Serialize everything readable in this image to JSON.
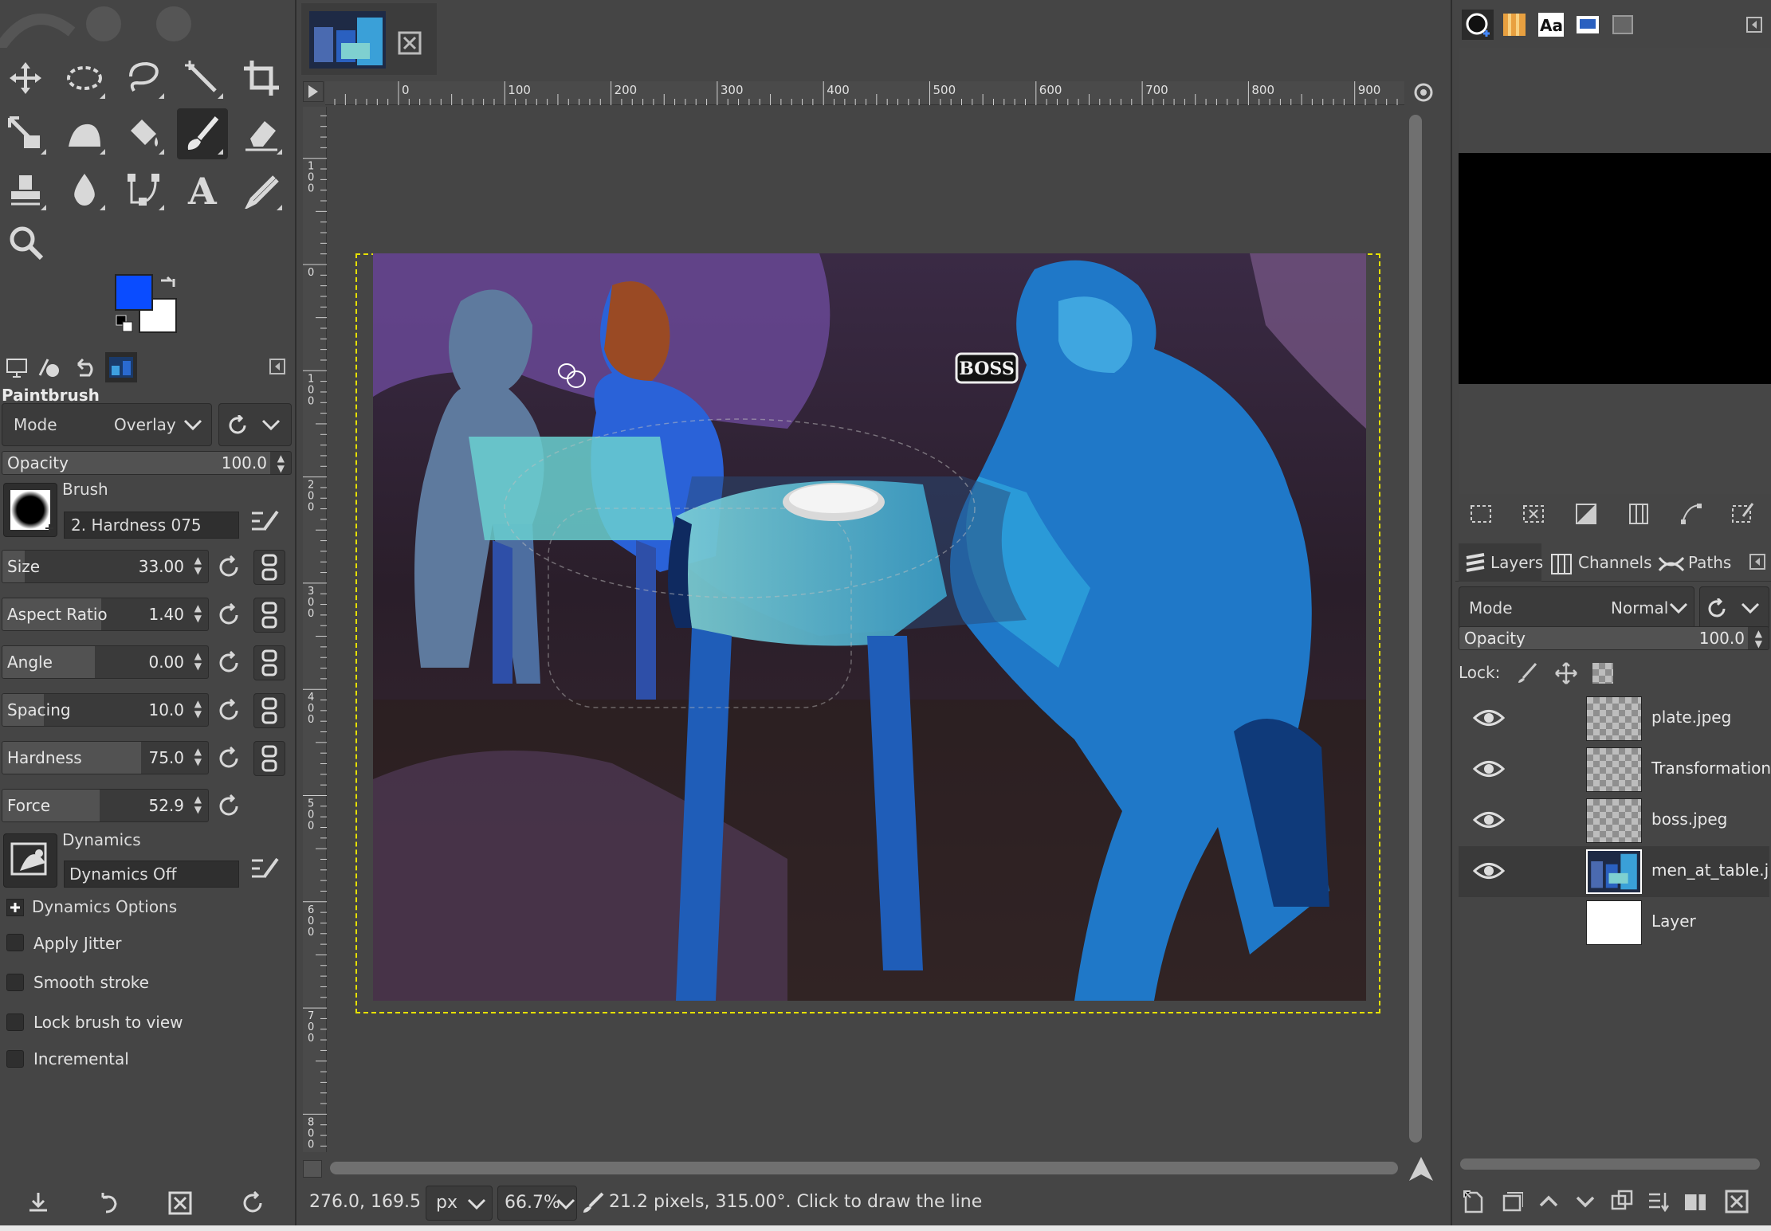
{
  "image_tab": {
    "close_icon": "close-icon"
  },
  "tool_options": {
    "title": "Paintbrush",
    "mode_label": "Mode",
    "mode_value": "Overlay",
    "opacity_label": "Opacity",
    "opacity_value": "100.0",
    "brush_label": "Brush",
    "brush_name": "2. Hardness 075",
    "size_label": "Size",
    "size_value": "33.00",
    "aspect_label": "Aspect Ratio",
    "aspect_value": "1.40",
    "angle_label": "Angle",
    "angle_value": "0.00",
    "spacing_label": "Spacing",
    "spacing_value": "10.0",
    "hardness_label": "Hardness",
    "hardness_value": "75.0",
    "force_label": "Force",
    "force_value": "52.9",
    "dynamics_label": "Dynamics",
    "dynamics_value": "Dynamics Off",
    "dynamics_options_label": "Dynamics Options",
    "apply_jitter_label": "Apply Jitter",
    "smooth_stroke_label": "Smooth stroke",
    "lock_brush_label": "Lock brush to view",
    "incremental_label": "Incremental"
  },
  "colors": {
    "foreground": "#0a4cff",
    "background": "#ffffff"
  },
  "ruler": {
    "top_ticks": [
      "0",
      "100",
      "200",
      "300",
      "400",
      "500",
      "600",
      "700",
      "800",
      "900"
    ],
    "left_ticks": [
      "1\n0\n0",
      "0",
      "1\n0\n0",
      "2\n0\n0",
      "3\n0\n0",
      "4\n0\n0",
      "5\n0\n0",
      "6\n0\n0",
      "7\n0\n0",
      "8\n0\n0"
    ]
  },
  "canvas": {
    "boss_label": "BOSS"
  },
  "status": {
    "coords": "276.0, 169.5",
    "unit": "px",
    "zoom": "66.7%",
    "message": "21.2 pixels, 315.00°. Click to draw the line"
  },
  "layers_panel": {
    "tabs": [
      "Layers",
      "Channels",
      "Paths"
    ],
    "mode_label": "Mode",
    "mode_value": "Normal",
    "opacity_label": "Opacity",
    "opacity_value": "100.0",
    "lock_label": "Lock:",
    "layers": [
      {
        "name": "plate.jpeg"
      },
      {
        "name": "Transformation"
      },
      {
        "name": "boss.jpeg"
      },
      {
        "name": "men_at_table.jpe"
      },
      {
        "name": "Layer"
      }
    ]
  },
  "brushes_panel": {
    "text_tab_label": "Aa"
  }
}
